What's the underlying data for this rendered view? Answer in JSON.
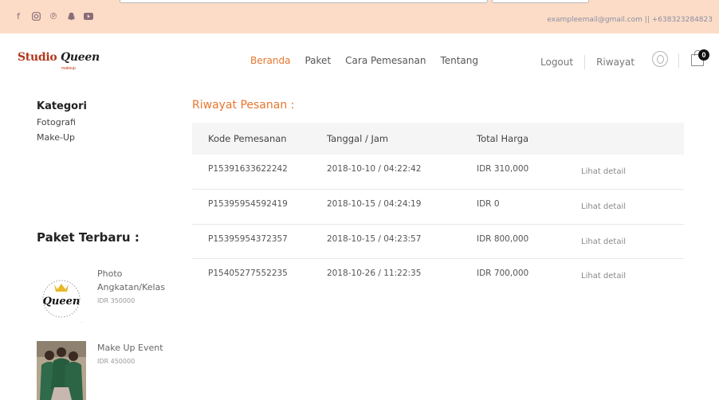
{
  "topbar": {
    "social_icons": [
      "facebook-icon",
      "instagram-icon",
      "pinterest-icon",
      "snapchat-icon",
      "youtube-icon"
    ],
    "contact": "exampleemail@gmail.com || +638323284823"
  },
  "brand": {
    "name_part1": "Studio",
    "name_part2": "Queen",
    "tagline": "makeup"
  },
  "nav": {
    "links": [
      "Beranda",
      "Paket",
      "Cara Pemesanan",
      "Tentang"
    ],
    "active": "Beranda",
    "logout": "Logout",
    "riwayat": "Riwayat",
    "cart_count": "0"
  },
  "sidebar": {
    "kategori_title": "Kategori",
    "kategori": [
      "Fotografi",
      "Make-Up"
    ],
    "paket_title": "Paket Terbaru :",
    "paket": [
      {
        "name_line1": "Photo",
        "name_line2": "Angkatan/Kelas",
        "price": "IDR 350000"
      },
      {
        "name_line1": "Make Up Event",
        "price": "IDR 450000"
      }
    ]
  },
  "main": {
    "title": "Riwayat Pesanan :",
    "columns": [
      "Kode Pemesanan",
      "Tanggal / Jam",
      "Total Harga"
    ],
    "rows": [
      {
        "kode": "P15391633622242",
        "tanggal": "2018-10-10 / 04:22:42",
        "total": "IDR 310,000",
        "action": "Lihat detail"
      },
      {
        "kode": "P15395954592419",
        "tanggal": "2018-10-15 / 04:24:19",
        "total": "IDR 0",
        "action": "Lihat detail"
      },
      {
        "kode": "P15395954372357",
        "tanggal": "2018-10-15 / 04:23:57",
        "total": "IDR 800,000",
        "action": "Lihat detail"
      },
      {
        "kode": "P15405277552235",
        "tanggal": "2018-10-26 / 11:22:35",
        "total": "IDR 700,000",
        "action": "Lihat detail"
      }
    ]
  },
  "colors": {
    "accent": "#e7762d",
    "topbar_bg": "#fcdcc6",
    "brand": "#b0381c"
  }
}
